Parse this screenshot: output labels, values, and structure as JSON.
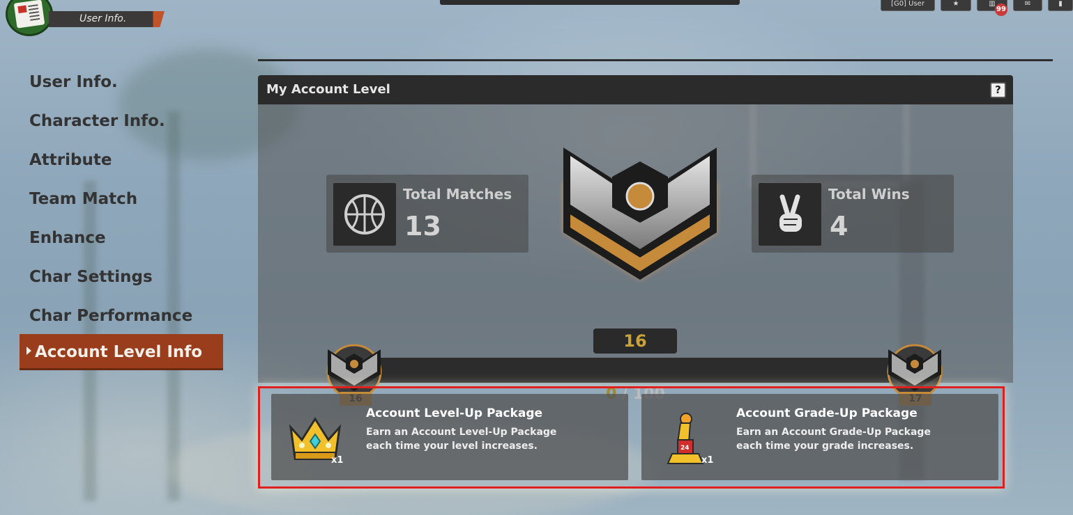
{
  "header": {
    "user_tab_label": "User Info.",
    "top_icons": {
      "currency_label": "[G0]",
      "user_label": "User",
      "notifications_badge": "99"
    }
  },
  "sidebar": {
    "items": [
      {
        "label": "User Info."
      },
      {
        "label": "Character Info."
      },
      {
        "label": "Attribute"
      },
      {
        "label": "Team Match"
      },
      {
        "label": "Enhance"
      },
      {
        "label": "Char Settings"
      },
      {
        "label": "Char Performance"
      },
      {
        "label": "Account Level Info",
        "active": true
      }
    ]
  },
  "panel": {
    "title": "My Account Level",
    "help_label": "?",
    "stats": {
      "total_matches": {
        "label": "Total Matches",
        "value": "13",
        "icon": "basketball-icon"
      },
      "total_wins": {
        "label": "Total Wins",
        "value": "4",
        "icon": "victory-hand-icon"
      }
    },
    "level": {
      "current": "16",
      "next": "17",
      "progress_current": "0",
      "progress_max": "100",
      "progress_separator": "/",
      "progress_fraction": 0.0
    },
    "packages": [
      {
        "title": "Account Level-Up Package",
        "desc_line1": "Earn an Account Level-Up Package",
        "desc_line2": "each time your level increases.",
        "qty": "x1",
        "icon": "crown-icon"
      },
      {
        "title": "Account Grade-Up Package",
        "desc_line1": "Earn an Account Grade-Up Package",
        "desc_line2": "each time your grade increases.",
        "qty": "x1",
        "icon": "trophy-icon"
      }
    ]
  },
  "colors": {
    "active_item_bg": "#9a3d1c",
    "level_gold": "#c9a33a",
    "highlight_border": "#e01f1f",
    "emblem_bronze": "#c58a3a"
  }
}
